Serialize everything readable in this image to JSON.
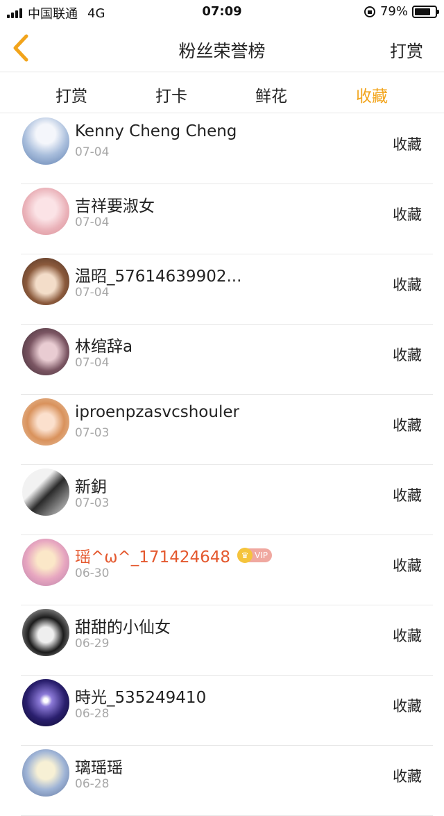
{
  "status_bar": {
    "carrier": "中国联通",
    "network": "4G",
    "time": "07:09",
    "battery_percent_label": "79%",
    "battery_level": 0.79
  },
  "nav": {
    "title": "粉丝荣誉榜",
    "action": "打赏",
    "back_icon": "chevron-left-icon",
    "accent_color": "#f2a41b"
  },
  "tabs": [
    {
      "label": "打赏",
      "active": false
    },
    {
      "label": "打卡",
      "active": false
    },
    {
      "label": "鲜花",
      "active": false
    },
    {
      "label": "收藏",
      "active": true
    }
  ],
  "fans": [
    {
      "name": "Kenny Cheng Cheng",
      "date": "07-04",
      "action": "收藏",
      "vip": false
    },
    {
      "name": "吉祥要淑女",
      "date": "07-04",
      "action": "收藏",
      "vip": false
    },
    {
      "name": "温昭_57614639902...",
      "date": "07-04",
      "action": "收藏",
      "vip": false
    },
    {
      "name": "林绾辞a",
      "date": "07-04",
      "action": "收藏",
      "vip": false
    },
    {
      "name": "iproenpzasvcshouler",
      "date": "07-03",
      "action": "收藏",
      "vip": false
    },
    {
      "name": "新鈅",
      "date": "07-03",
      "action": "收藏",
      "vip": false
    },
    {
      "name": "瑶^ω^_171424648",
      "date": "06-30",
      "action": "收藏",
      "vip": true,
      "vip_label": "VIP"
    },
    {
      "name": "甜甜的小仙女",
      "date": "06-29",
      "action": "收藏",
      "vip": false
    },
    {
      "name": "時光_535249410",
      "date": "06-28",
      "action": "收藏",
      "vip": false
    },
    {
      "name": "璃瑶瑶",
      "date": "06-28",
      "action": "收藏",
      "vip": false
    }
  ]
}
